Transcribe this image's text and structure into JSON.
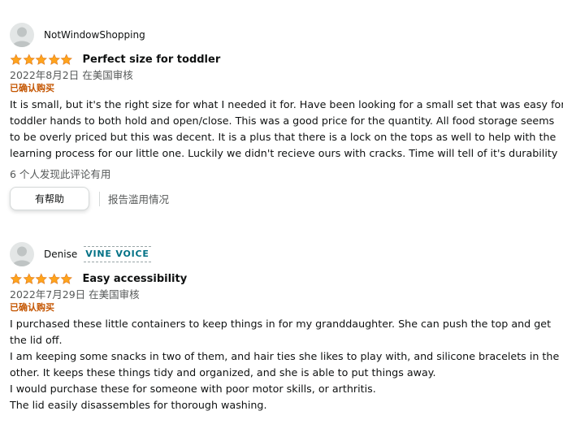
{
  "reviews": [
    {
      "author": "NotWindowShopping",
      "badge": "",
      "rating": 5,
      "title": "Perfect size for toddler",
      "date_location": "2022年8月2日 在美国审核",
      "verified": "已确认购买",
      "body_lines": [
        "It is small, but it's the right size for what I needed it for. Have been looking for a small set that was easy for",
        "toddler hands to both hold and open/close. This was a good price for the quantity. All food storage seems",
        "to be overly priced but this was decent. It is a plus that there is a lock on the tops as well to help with the",
        "learning process for our little one. Luckily we didn't recieve ours with cracks. Time will tell of it's durability"
      ],
      "helpful_count": "6 个人发现此评论有用",
      "helpful_button": "有帮助",
      "report": "报告滥用情况"
    },
    {
      "author": "Denise",
      "badge": "VINE VOICE",
      "rating": 5,
      "title": "Easy accessibility",
      "date_location": "2022年7月29日 在美国审核",
      "verified": "已确认购买",
      "body_lines": [
        "I purchased these little containers to keep things in for my granddaughter. She can push the top and get",
        "the lid off.",
        "I am keeping some snacks in two of them, and hair ties she likes to play with, and silicone bracelets in the",
        "other. It keeps these things tidy and organized, and she is able to put things away.",
        "I would purchase these for someone with poor motor skills, or arthritis.",
        "The lid easily disassembles for thorough washing."
      ]
    }
  ],
  "colors": {
    "star": "#ffa41c",
    "verified": "#c45500",
    "vine": "#007185"
  }
}
